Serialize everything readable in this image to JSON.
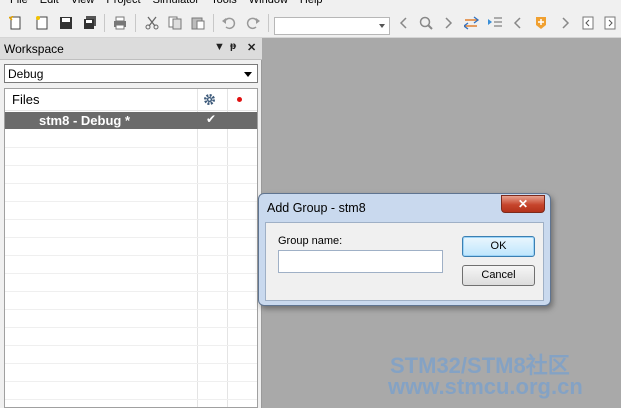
{
  "menu": [
    "File",
    "Edit",
    "View",
    "Project",
    "Simulator",
    "Tools",
    "Window",
    "Help"
  ],
  "toolbar": {
    "icons": [
      "new-icon",
      "new-file-icon",
      "save-icon",
      "save-all-icon",
      "print-icon",
      "cut-icon",
      "copy-icon",
      "paste-icon",
      "undo-icon",
      "redo-icon",
      "dropdown",
      "back-icon",
      "find-icon",
      "find-next-icon",
      "goto-icon",
      "bookmark-prev-icon",
      "bookmark-icon",
      "prev-icon",
      "next-icon"
    ],
    "combo_value": ""
  },
  "workspace": {
    "title": "Workspace",
    "controls": [
      "▼",
      "📌",
      "✕"
    ],
    "configuration": "Debug",
    "columns": {
      "files": "Files"
    },
    "items": [
      {
        "label": "stm8 - Debug *",
        "checked": "✔"
      }
    ]
  },
  "dialog": {
    "title": "Add Group - stm8",
    "close": "✕",
    "field_label": "Group name:",
    "field_value": "",
    "ok_label": "OK",
    "cancel_label": "Cancel"
  },
  "watermark": {
    "line1": "STM32/STM8社区",
    "line2": "www.stmcu.org.cn"
  },
  "colors": {
    "selected_row": "#6b6b6b",
    "dialog_frame": "#c9d9ee",
    "close_button": "#c6452c",
    "background": "#a9a9a9"
  }
}
